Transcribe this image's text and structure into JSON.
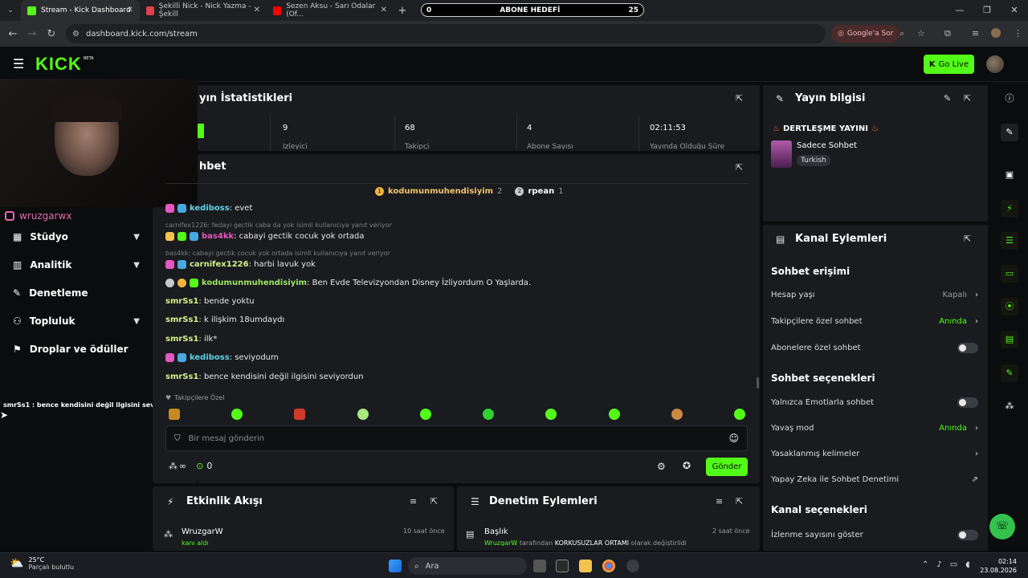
{
  "browser": {
    "tabs": [
      {
        "title": "Stream - Kick Dashboard",
        "active": true,
        "color": "#53fc18"
      },
      {
        "title": "Şekilli Nick - Nick Yazma - Şekill",
        "active": false,
        "color": "#e0404a"
      },
      {
        "title": "Sezen Aksu - Sarı Odalar (Of...",
        "active": false,
        "color": "#ff0000"
      }
    ],
    "new_tab": "+",
    "goal_bar": {
      "min": "0",
      "label": "ABONE HEDEFİ",
      "max": "25"
    },
    "url": "dashboard.kick.com/stream",
    "google_sor": "Google'a Sor"
  },
  "kick": {
    "logo": "KICK",
    "beta": "BETA",
    "go_live": "Go Live"
  },
  "sidebar": {
    "instagram_handle": "wruzgarwx",
    "items": [
      {
        "label": "Stüdyo",
        "has_children": true
      },
      {
        "label": "Analitik",
        "has_children": true
      },
      {
        "label": "Denetleme",
        "has_children": false
      },
      {
        "label": "Topluluk",
        "has_children": true
      },
      {
        "label": "Droplar ve ödüller",
        "has_children": false
      }
    ],
    "overlay_chat": "smrSs1 : bence kendisini değil ilgisini seviyordun"
  },
  "stats": {
    "title": "yın İstatistikleri",
    "items": [
      {
        "value": "9",
        "label": "İzleyici"
      },
      {
        "value": "68",
        "label": "Takipçi"
      },
      {
        "value": "4",
        "label": "Abone Sayısı"
      },
      {
        "value": "02:11:53",
        "label": "Yayında Olduğu Süre"
      }
    ]
  },
  "chat": {
    "title": "hbet",
    "top_gifters": [
      {
        "name": "kodumunmuhendisiyim",
        "count": "2",
        "rank": "1"
      },
      {
        "name": "rpean",
        "count": "1",
        "rank": "2"
      }
    ],
    "messages": [
      {
        "user": "kediboss",
        "text": " evet",
        "style": "cyan"
      },
      {
        "reply": "carnifex1226: fedayi gectik caba da yok isimli kullanıcıya yanıt veriyor"
      },
      {
        "user": "bas4kk",
        "text": " cabayi gectik cocuk yok ortada",
        "style": "pink"
      },
      {
        "reply": "bas4kk: cabayi gectik cocuk yok ortada isimli kullanıcıya yanıt veriyor"
      },
      {
        "user": "carnifex1226",
        "text": " harbi lavuk yok",
        "style": "lime"
      },
      {
        "user": "kodumunmuhendisiyim",
        "text": " Ben Evde Televizyondan Disney İzliyordum O Yaşlarda.",
        "style": "green"
      },
      {
        "user": "smrSs1",
        "text": " bende yoktu",
        "style": "lime"
      },
      {
        "user": "smrSs1",
        "text": " k ilişkim 18umdaydı",
        "style": "lime"
      },
      {
        "user": "smrSs1",
        "text": " ilk*",
        "style": "lime"
      },
      {
        "user": "kediboss",
        "text": " seviyodum",
        "style": "cyan"
      },
      {
        "user": "smrSs1",
        "text": " bence kendisini değil ilgisini seviyordun",
        "style": "lime"
      }
    ],
    "followers_only": "Takipçilere Özel",
    "input_placeholder": "Bir mesaj gönderin",
    "points": "∞",
    "coins": "0",
    "send": "Gönder"
  },
  "activity": {
    "title": "Etkinlik Akışı",
    "item_user": "WruzgarW",
    "item_time": "10 saat önce",
    "item_sub": "kanı aldı"
  },
  "moderation": {
    "title": "Denetim Eylemleri",
    "item_title": "Başlık",
    "item_time": "2 saat önce",
    "item_by": "WruzgarW",
    "item_mid": " tarafından ",
    "item_value": "KORKUSUZLAR ORTAMI",
    "item_tail": " olarak değiştirildi"
  },
  "stream_info": {
    "title": "Yayın bilgisi",
    "stream_title": "DERTLEŞME YAYINI",
    "category": "Sadece Sohbet",
    "language": "Turkish"
  },
  "channel_actions": {
    "title": "Kanal Eylemleri",
    "sections": [
      {
        "heading": "Sohbet erişimi"
      },
      {
        "heading": "Sohbet seçenekleri"
      },
      {
        "heading": "Kanal seçenekleri"
      }
    ],
    "rows": {
      "hesap_yasi": {
        "label": "Hesap yaşı",
        "value": "Kapalı"
      },
      "takipci_ozel": {
        "label": "Takipçilere özel sohbet",
        "value": "Anında"
      },
      "abone_ozel": {
        "label": "Abonelere özel sohbet"
      },
      "emote_only": {
        "label": "Yalnızca Emotlarla sohbet"
      },
      "yavas_mod": {
        "label": "Yavaş mod",
        "value": "Anında"
      },
      "yasakli": {
        "label": "Yasaklanmış kelimeler"
      },
      "ai_mod": {
        "label": "Yapay Zeka ile Sohbet Denetimi"
      },
      "izlenme": {
        "label": "İzlenme sayısını göster"
      }
    }
  },
  "taskbar": {
    "temp": "25°C",
    "weather": "Parçalı bulutlu",
    "search": "Ara",
    "time": "02:14",
    "date": "23.08.2026"
  },
  "colors": {
    "accent": "#53fc18",
    "panel": "#191b1f",
    "bg": "#0b0c0d"
  }
}
